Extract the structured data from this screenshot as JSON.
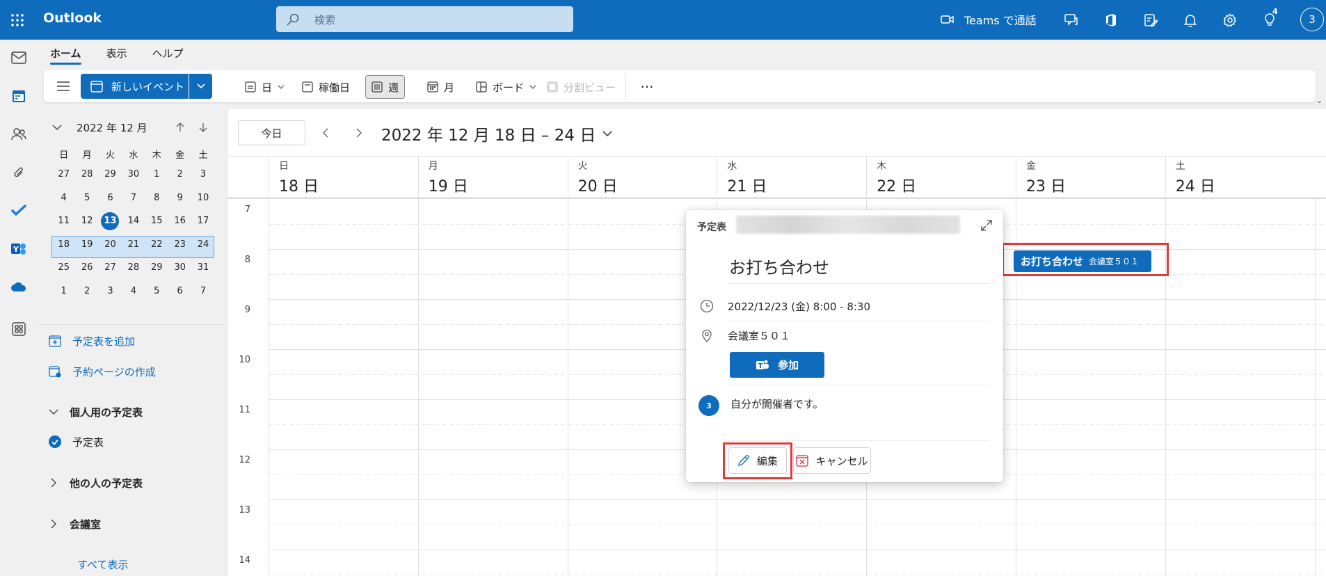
{
  "app": {
    "title": "Outlook"
  },
  "search": {
    "placeholder": "検索"
  },
  "topbar": {
    "teams_call_label": "Teams で通話",
    "tips_badge": "4",
    "avatar_initial": "3"
  },
  "tabs": [
    {
      "label": "ホーム",
      "active": true
    },
    {
      "label": "表示"
    },
    {
      "label": "ヘルプ"
    }
  ],
  "ribbon": {
    "new_event_label": "新しいイベント",
    "day_label": "日",
    "workweek_label": "稼働日",
    "week_label": "週",
    "month_label": "月",
    "board_label": "ボード",
    "split_label": "分割ビュー",
    "more_label": "···"
  },
  "minical": {
    "title": "2022 年 12 月",
    "dow": [
      "日",
      "月",
      "火",
      "水",
      "木",
      "金",
      "土"
    ],
    "weeks": [
      [
        "27",
        "28",
        "29",
        "30",
        "1",
        "2",
        "3"
      ],
      [
        "4",
        "5",
        "6",
        "7",
        "8",
        "9",
        "10"
      ],
      [
        "11",
        "12",
        "13",
        "14",
        "15",
        "16",
        "17"
      ],
      [
        "18",
        "19",
        "20",
        "21",
        "22",
        "23",
        "24"
      ],
      [
        "25",
        "26",
        "27",
        "28",
        "29",
        "30",
        "31"
      ],
      [
        "1",
        "2",
        "3",
        "4",
        "5",
        "6",
        "7"
      ]
    ],
    "today": "13"
  },
  "leftpanel": {
    "add_calendar": "予定表を追加",
    "booking_page": "予約ページの作成",
    "my_calendars": "個人用の予定表",
    "calendar": "予定表",
    "others_calendars": "他の人の予定表",
    "rooms": "会議室",
    "show_all": "すべて表示"
  },
  "calendar": {
    "today_label": "今日",
    "range_title": "2022 年 12 月 18 日 – 24 日",
    "days": [
      {
        "dow": "日",
        "num": "18 日"
      },
      {
        "dow": "月",
        "num": "19 日"
      },
      {
        "dow": "火",
        "num": "20 日"
      },
      {
        "dow": "水",
        "num": "21 日"
      },
      {
        "dow": "木",
        "num": "22 日"
      },
      {
        "dow": "金",
        "num": "23 日"
      },
      {
        "dow": "土",
        "num": "24 日"
      }
    ],
    "hours": [
      "7",
      "8",
      "9",
      "10",
      "11",
      "12",
      "13",
      "14"
    ]
  },
  "event": {
    "title": "お打ち合わせ",
    "location": "会議室５０１"
  },
  "popup": {
    "calendar_label": "予定表",
    "title": "お打ち合わせ",
    "datetime": "2022/12/23 (金) 8:00 - 8:30",
    "location": "会議室５０１",
    "join_label": "参加",
    "organizer_initial": "3",
    "organizer_text": "自分が開催者です。",
    "edit_label": "編集",
    "cancel_label": "キャンセル"
  },
  "colors": {
    "brand": "#0f6cbd",
    "highlight_red": "#e03c3c"
  }
}
